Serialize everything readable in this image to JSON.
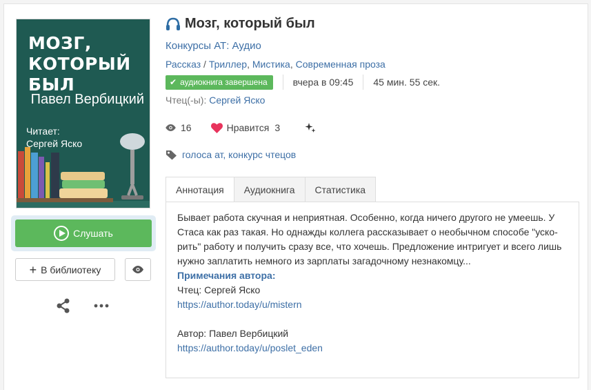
{
  "cover": {
    "title": "МОЗГ, КОТОРЫЙ БЫЛ",
    "author": "Павел Вербицкий",
    "reader_line1": "Читает:",
    "reader_line2": "Сергей Яско"
  },
  "actions": {
    "listen_label": "Слушать",
    "library_label": "В библиотеку"
  },
  "book": {
    "title": "Мозг, который был",
    "contest": "Конкурсы АТ: Аудио",
    "genre_main": "Рассказ",
    "genres": [
      "Триллер",
      "Мистика",
      "Современная проза"
    ],
    "status_badge": "аудиокнига завершена",
    "updated": "вчера в 09:45",
    "duration": "45 мин. 55 сек.",
    "reader_label": "Чтец(-ы):",
    "reader_name": "Сергей Яско"
  },
  "stats": {
    "views": "16",
    "likes_label": "Нравится",
    "likes_count": "3"
  },
  "tags": "голоса ат, конкурс чтецов",
  "tabs": [
    "Аннотация",
    "Аудиокнига",
    "Статистика"
  ],
  "annotation": {
    "text": "Бывает работа скучная и неприятная. Особенно, когда ничего другого не умеешь. У Стаса как раз такая. Но однажды коллега рассказывает о необычном способе \"уско-рить\" работу и получить сразу все, что хочешь. Предложение интригует и всего лишь нужно заплатить немного из зарплаты загадочному незнакомцу...",
    "notes_title": "Примечания автора:",
    "note1": "Чтец: Сергей Яско",
    "link1": "https://author.today/u/mistern",
    "note2": "Автор: Павел Вербицкий",
    "link2": "https://author.today/u/poslet_eden"
  },
  "colors": {
    "accent": "#3d6fa6",
    "green": "#5cb85c",
    "cover_bg": "#1f5a52",
    "heart": "#e8335c"
  }
}
